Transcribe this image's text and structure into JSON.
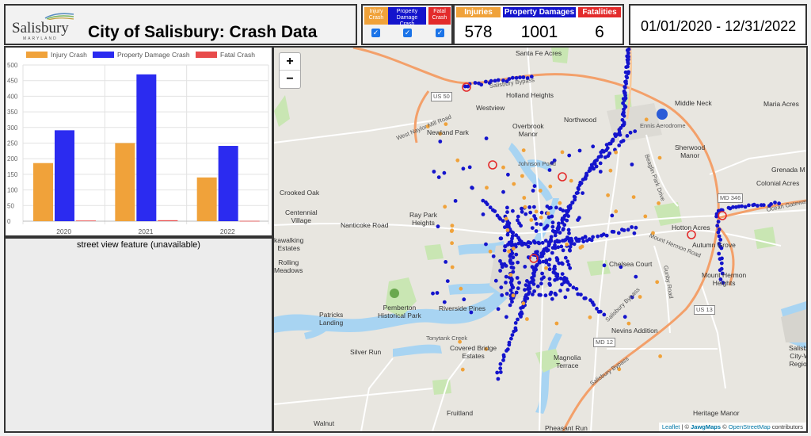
{
  "header": {
    "logo_text": "Salisbury",
    "logo_sub": "MARYLAND",
    "title": "City of Salisbury: Crash Data",
    "date_range": "01/01/2020 - 12/31/2022"
  },
  "filters": [
    {
      "label": "Injury Crash",
      "color": "#f0a23a",
      "checked": true
    },
    {
      "label": "Property Damage Crash",
      "color": "#1414cc",
      "checked": true
    },
    {
      "label": "Fatal Crash",
      "color": "#e32b2b",
      "checked": true
    }
  ],
  "stats": [
    {
      "label": "Injuries",
      "value": "578",
      "color": "#f0a23a"
    },
    {
      "label": "Property Damages",
      "value": "1001",
      "color": "#1414cc"
    },
    {
      "label": "Fatalities",
      "value": "6",
      "color": "#e32b2b"
    }
  ],
  "chart_data": {
    "type": "bar",
    "categories": [
      "2020",
      "2021",
      "2022"
    ],
    "series": [
      {
        "name": "Injury Crash",
        "color": "#f0a23a",
        "values": [
          186,
          250,
          140
        ]
      },
      {
        "name": "Property Damage Crash",
        "color": "#2b2bf0",
        "values": [
          291,
          470,
          241
        ]
      },
      {
        "name": "Fatal Crash",
        "color": "#e84b4b",
        "values": [
          2,
          3,
          1
        ]
      }
    ],
    "ylim": [
      0,
      500
    ],
    "yticks": [
      "0",
      "50",
      "100",
      "150",
      "200",
      "250",
      "300",
      "350",
      "400",
      "450",
      "500"
    ],
    "legend_position": "top",
    "grid": true
  },
  "street_view": {
    "text": "street view feature (unavailable)"
  },
  "map": {
    "zoom_in": "+",
    "zoom_out": "−",
    "attribution": {
      "leaflet": "Leaflet",
      "sep": " | © ",
      "jawg": "JawgMaps",
      "osm": "OpenStreetMap",
      "tail": " contributors"
    },
    "places": [
      {
        "name": "Santa Fe Acres",
        "x": 305,
        "y": 2
      },
      {
        "name": "Holland Heights",
        "x": 293,
        "y": 55
      },
      {
        "name": "Middle Neck",
        "x": 506,
        "y": 65
      },
      {
        "name": "Maria Acres",
        "x": 618,
        "y": 66
      },
      {
        "name": "Westview",
        "x": 255,
        "y": 71
      },
      {
        "name": "Northwood",
        "x": 366,
        "y": 86
      },
      {
        "name": "Newland Park",
        "x": 193,
        "y": 102
      },
      {
        "name": "Overbrook\nManor",
        "x": 301,
        "y": 94
      },
      {
        "name": "Sherwood\nManor",
        "x": 506,
        "y": 121
      },
      {
        "name": "Grenada M",
        "x": 628,
        "y": 149
      },
      {
        "name": "Colonial Acres",
        "x": 609,
        "y": 166
      },
      {
        "name": "Crooked Oak",
        "x": 7,
        "y": 178
      },
      {
        "name": "Centennial\nVillage",
        "x": 14,
        "y": 203
      },
      {
        "name": "Ray Park\nHeights",
        "x": 171,
        "y": 206
      },
      {
        "name": "Nanticoke Road",
        "x": 84,
        "y": 219
      },
      {
        "name": "Hotton Acres",
        "x": 502,
        "y": 222
      },
      {
        "name": "Autumn Grove",
        "x": 528,
        "y": 244
      },
      {
        "name": "kawalking\nEstates",
        "x": 0,
        "y": 238
      },
      {
        "name": "Rolling\nMeadows",
        "x": 0,
        "y": 266
      },
      {
        "name": "Chelsea Court",
        "x": 423,
        "y": 268
      },
      {
        "name": "Mount Hermon\nHeights",
        "x": 540,
        "y": 282
      },
      {
        "name": "Patricks\nLanding",
        "x": 57,
        "y": 332
      },
      {
        "name": "Pemberton\nHistorical Park",
        "x": 131,
        "y": 323
      },
      {
        "name": "Riverside Pines",
        "x": 208,
        "y": 324
      },
      {
        "name": "Nevins Addition",
        "x": 426,
        "y": 352
      },
      {
        "name": "Silver Run",
        "x": 96,
        "y": 379
      },
      {
        "name": "Covered Bridge\nEstates",
        "x": 222,
        "y": 374
      },
      {
        "name": "Magnolia\nTerrace",
        "x": 353,
        "y": 386
      },
      {
        "name": "Salisbu\nCity-W\nRegion",
        "x": 650,
        "y": 374
      },
      {
        "name": "Fruitland",
        "x": 218,
        "y": 456
      },
      {
        "name": "Heritage Manor",
        "x": 529,
        "y": 456
      },
      {
        "name": "Walnut",
        "x": 50,
        "y": 469
      },
      {
        "name": "Pheasant Run",
        "x": 342,
        "y": 475
      }
    ],
    "road_labels": [
      {
        "name": "West Naylor Mill Road",
        "x": 155,
        "y": 110,
        "rot": -22
      },
      {
        "name": "Salisbury Bypass",
        "x": 272,
        "y": 44,
        "rot": -8
      },
      {
        "name": "Beaglin Park Drive",
        "x": 470,
        "y": 130,
        "rot": 70
      },
      {
        "name": "Mount Hermon Road",
        "x": 474,
        "y": 232,
        "rot": 22
      },
      {
        "name": "Gunby Road",
        "x": 494,
        "y": 270,
        "rot": 80
      },
      {
        "name": "Ocean Gateway",
        "x": 622,
        "y": 200,
        "rot": -12
      },
      {
        "name": "Tonytank Creek",
        "x": 192,
        "y": 362,
        "rot": 0
      },
      {
        "name": "Johnson Pond",
        "x": 308,
        "y": 142,
        "rot": 0
      },
      {
        "name": "Salisbury Bypass",
        "x": 400,
        "y": 420,
        "rot": -35
      },
      {
        "name": "Ennis Aerodrome",
        "x": 462,
        "y": 94,
        "rot": 0
      },
      {
        "name": "Salisbury Bypass",
        "x": 420,
        "y": 340,
        "rot": -45
      }
    ],
    "shields": [
      {
        "name": "MD 346",
        "x": 560,
        "y": 184
      },
      {
        "name": "US 13",
        "x": 530,
        "y": 325
      },
      {
        "name": "MD 12",
        "x": 403,
        "y": 366
      },
      {
        "name": "US 50",
        "x": 198,
        "y": 56
      }
    ]
  }
}
